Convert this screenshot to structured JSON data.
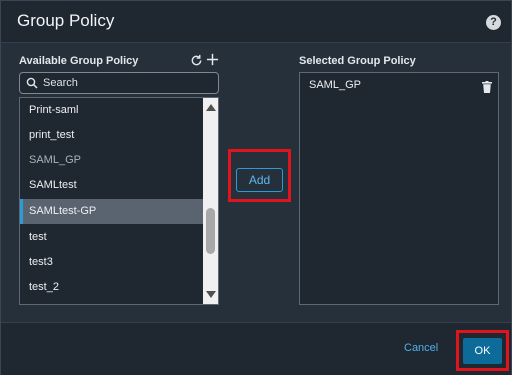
{
  "dialog": {
    "title": "Group Policy",
    "help_icon": "help-icon",
    "help_glyph": "?"
  },
  "available": {
    "label": "Available Group Policy",
    "refresh_icon": "refresh-icon",
    "add_icon": "plus-icon",
    "search": {
      "placeholder": "Search",
      "value": ""
    },
    "items": [
      {
        "label": "Print-saml",
        "state": "normal"
      },
      {
        "label": "print_test",
        "state": "normal"
      },
      {
        "label": "SAML_GP",
        "state": "dimmed"
      },
      {
        "label": "SAMLtest",
        "state": "normal"
      },
      {
        "label": "SAMLtest-GP",
        "state": "selected"
      },
      {
        "label": "test",
        "state": "normal"
      },
      {
        "label": "test3",
        "state": "normal"
      },
      {
        "label": "test_2",
        "state": "normal"
      }
    ]
  },
  "add_button": {
    "label": "Add"
  },
  "selected": {
    "label": "Selected Group Policy",
    "items": [
      {
        "label": "SAML_GP",
        "icon": "trash-icon"
      }
    ]
  },
  "footer": {
    "cancel_label": "Cancel",
    "ok_label": "OK"
  },
  "colors": {
    "accent": "#2e9bd6",
    "primary_button": "#0d6b9a",
    "highlight": "#e0141d"
  }
}
